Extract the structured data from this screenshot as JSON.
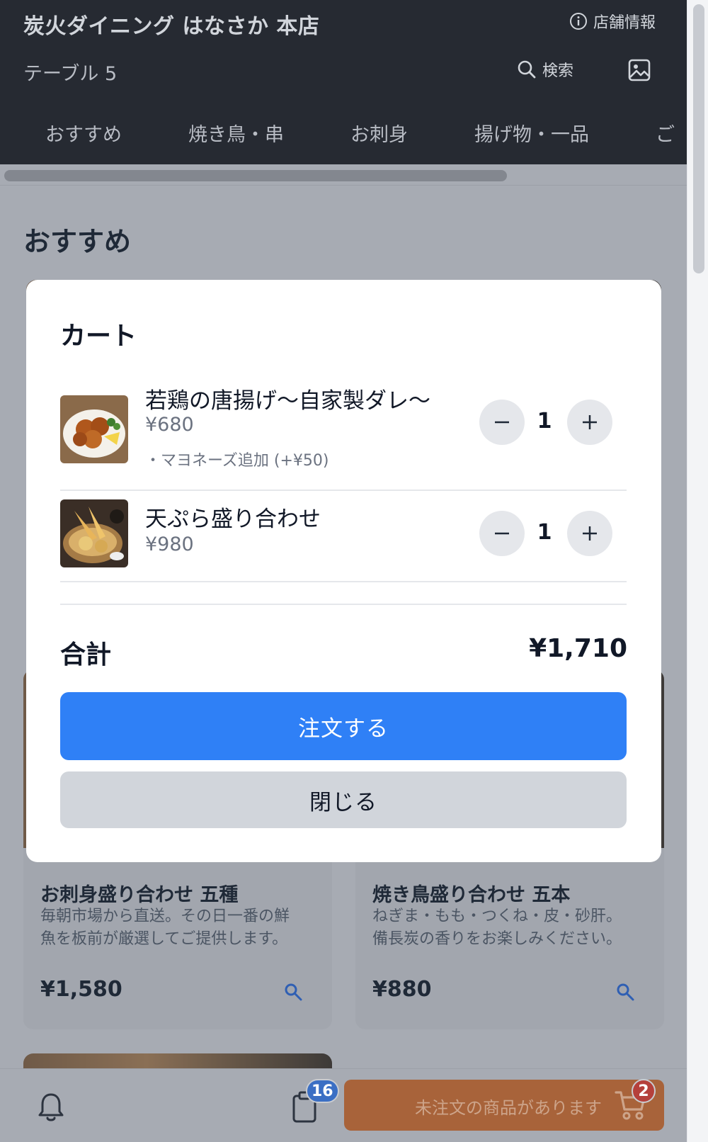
{
  "header": {
    "store_name": "炭火ダイニング はなさか 本店",
    "store_info_label": "店舗情報",
    "table_label": "テーブル 5",
    "search_label": "検索",
    "tabs": [
      "おすすめ",
      "焼き鳥・串",
      "お刺身",
      "揚げ物・一品",
      "ご"
    ]
  },
  "section_title": "おすすめ",
  "menu_cards": [
    {
      "title": "お刺身盛り合わせ 五種",
      "desc_line1": "毎朝市場から直送。その日一番の鮮",
      "desc_line2": "魚を板前が厳選してご提供します。",
      "price": "¥1,580"
    },
    {
      "title": "焼き鳥盛り合わせ 五本",
      "desc_line1": "ねぎま・もも・つくね・皮・砂肝。",
      "desc_line2": "備長炭の香りをお楽しみください。",
      "price": "¥880"
    }
  ],
  "bottom_bar": {
    "history_badge": "16",
    "cart_badge": "2",
    "order_notice": "未注文の商品があります"
  },
  "cart": {
    "title": "カート",
    "items": [
      {
        "name": "若鶏の唐揚げ〜自家製ダレ〜",
        "price": "¥680",
        "option": "・マヨネーズ追加 (+¥50)",
        "quantity": "1"
      },
      {
        "name": "天ぷら盛り合わせ",
        "price": "¥980",
        "quantity": "1"
      }
    ],
    "total_label": "合計",
    "total_value": "¥1,710",
    "order_button": "注文する",
    "close_button": "閉じる"
  },
  "colors": {
    "header_bg": "#262a32",
    "primary": "#2f80f6",
    "order_bar": "#a8633a",
    "badge_blue": "#3b6fc4",
    "badge_red": "#b5403b"
  }
}
